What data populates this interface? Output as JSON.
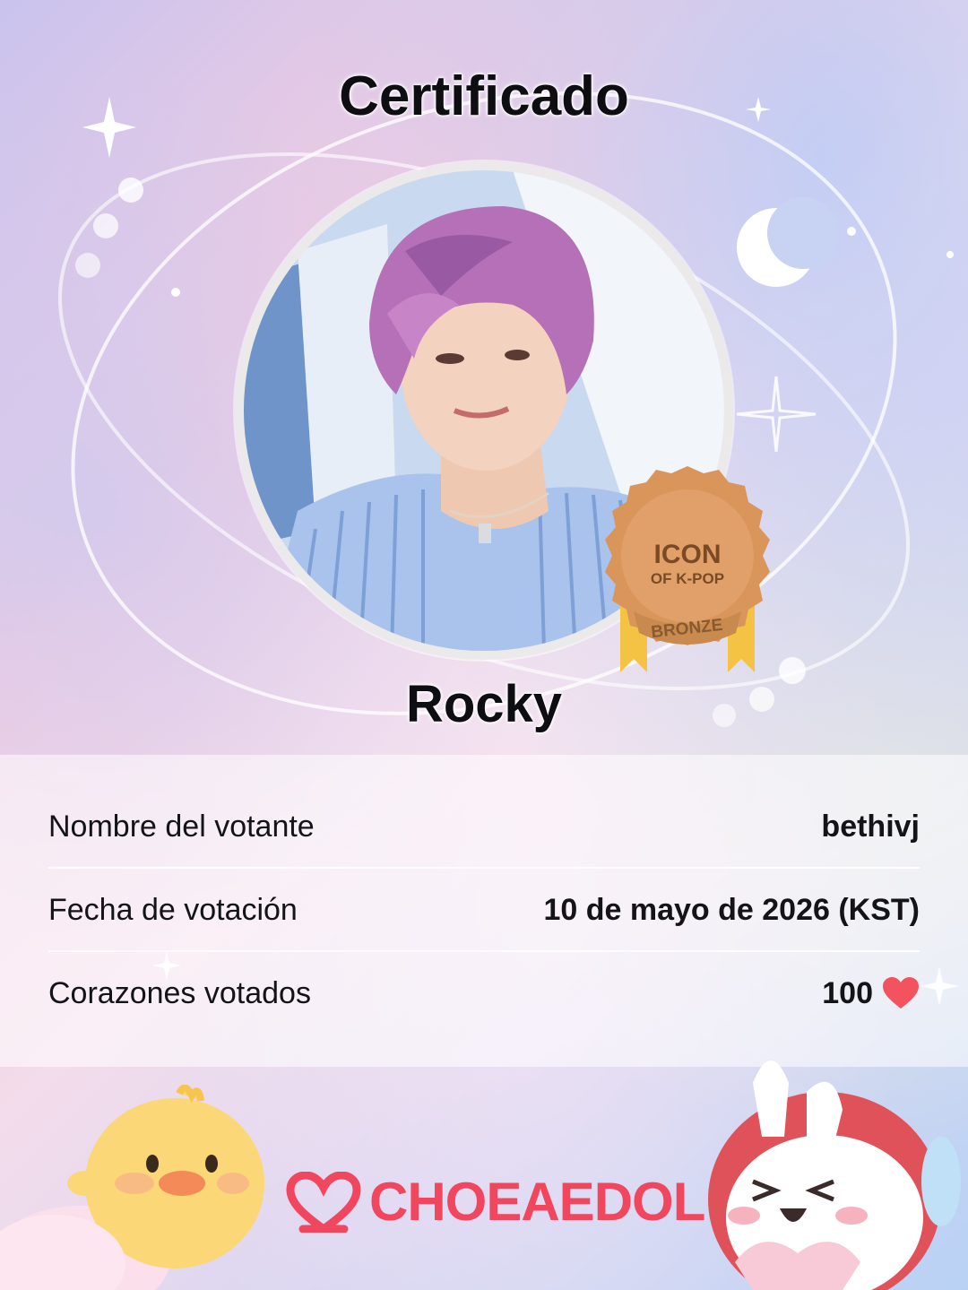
{
  "certificate": {
    "title": "Certificado",
    "idol_name": "Rocky",
    "badge": {
      "line1": "ICON",
      "line2": "OF K-POP",
      "tier": "BRONZE"
    },
    "rows": [
      {
        "label": "Nombre del votante",
        "value": "bethivj"
      },
      {
        "label": "Fecha de votación",
        "value": "10 de mayo de 2026 (KST)"
      },
      {
        "label": "Corazones votados",
        "value": "100"
      }
    ],
    "heart_icon": "heart-icon"
  },
  "brand": {
    "name": "CHOEAEDOL",
    "color": "#f0475f"
  },
  "colors": {
    "badge_bronze": "#d9955a",
    "ribbon": "#f5c343",
    "text_dark": "#0d0d12"
  }
}
